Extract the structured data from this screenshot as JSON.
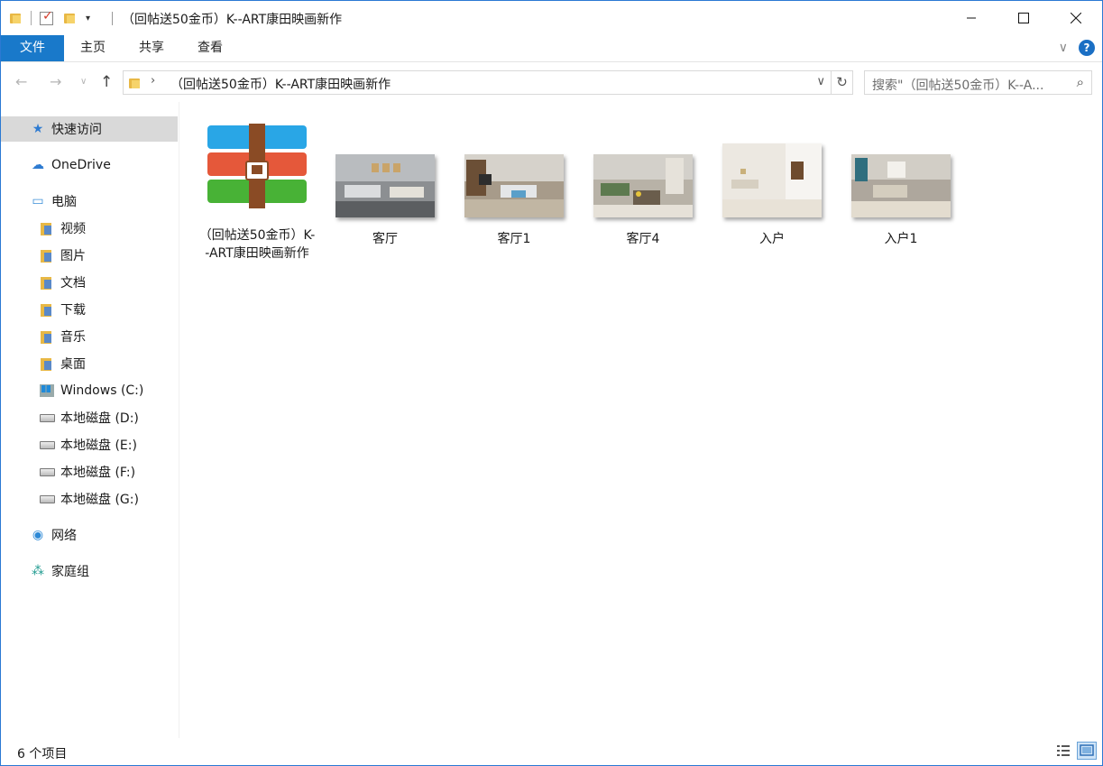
{
  "window": {
    "title": "（回帖送50金币）K--ART康田映画新作"
  },
  "ribbon": {
    "tabs": [
      "文件",
      "主页",
      "共享",
      "查看"
    ]
  },
  "address": {
    "path": "（回帖送50金币）K--ART康田映画新作",
    "search_placeholder": "搜索\"（回帖送50金币）K--A..."
  },
  "sidebar": {
    "quick_access": "快速访问",
    "onedrive": "OneDrive",
    "this_pc": "电脑",
    "pc_items": [
      "视频",
      "图片",
      "文档",
      "下载",
      "音乐",
      "桌面"
    ],
    "drives": [
      "Windows (C:)",
      "本地磁盘 (D:)",
      "本地磁盘 (E:)",
      "本地磁盘 (F:)",
      "本地磁盘 (G:)"
    ],
    "network": "网络",
    "homegroup": "家庭组"
  },
  "files": [
    {
      "name": "（回帖送50金币）K--ART康田映画新作",
      "type": "archive"
    },
    {
      "name": "客厅",
      "type": "image"
    },
    {
      "name": "客厅1",
      "type": "image"
    },
    {
      "name": "客厅4",
      "type": "image"
    },
    {
      "name": "入户",
      "type": "image"
    },
    {
      "name": "入户1",
      "type": "image"
    }
  ],
  "status": {
    "item_count": "6 个项目"
  },
  "colors": {
    "accent": "#1979ca",
    "selection": "#d9d9d9"
  }
}
